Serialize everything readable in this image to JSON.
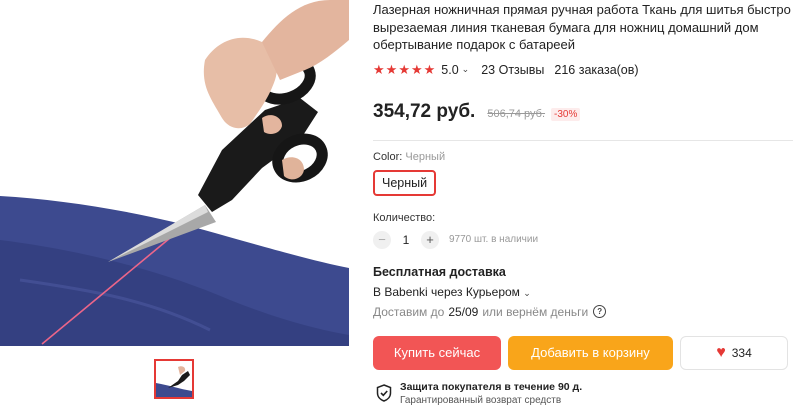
{
  "product": {
    "title": "Лазерная ножничная прямая ручная работа Ткань для шитья быстро вырезаемая линия тканевая бумага для ножниц домашний дом обертывание подарок с батареей",
    "rating": "5.0",
    "reviews": "23 Отзывы",
    "orders": "216 заказа(ов)",
    "price": "354,72 руб.",
    "old_price": "506,74 руб.",
    "discount": "-30%"
  },
  "variant": {
    "label": "Color:",
    "selected_name": "Черный",
    "chip_label": "Черный"
  },
  "quantity": {
    "label": "Количество:",
    "value": "1",
    "minus": "−",
    "plus": "+",
    "stock": "9770 шт. в наличии"
  },
  "shipping": {
    "title": "Бесплатная доставка",
    "route": "В Babenki через Курьером",
    "deliver_prefix": "Доставим до",
    "date": "25/09",
    "deliver_suffix": "или вернём деньги"
  },
  "actions": {
    "buy_now": "Купить сейчас",
    "add_to_cart": "Добавить в корзину",
    "wishlist_count": "334"
  },
  "protection": {
    "title": "Защита покупателя в течение 90 д.",
    "subtitle": "Гарантированный возврат средств"
  },
  "icons": {
    "star": "star-icon",
    "heart": "heart-icon",
    "shield": "shield-check-icon",
    "help": "question-circle-icon",
    "chevron": "chevron-down-icon"
  },
  "colors": {
    "accent_red": "#e53935",
    "buy_button": "#f25555",
    "cart_button": "#f9a51a"
  }
}
